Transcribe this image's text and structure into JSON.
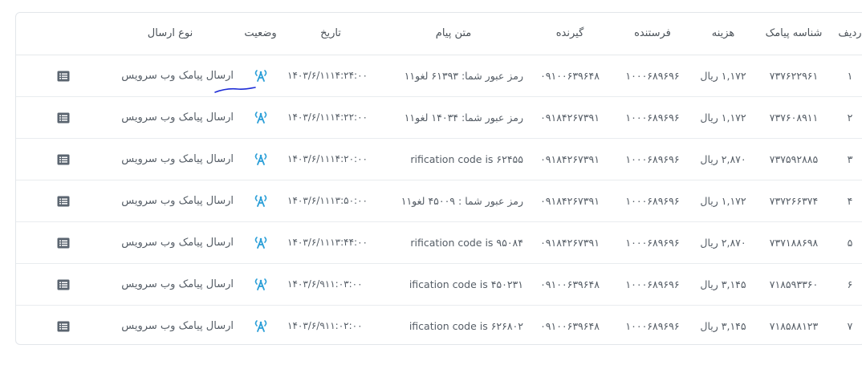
{
  "table": {
    "headers": {
      "row": "ردیف",
      "id": "شناسه پیامک",
      "cost": "هزینه",
      "sender": "فرستنده",
      "receiver": "گیرنده",
      "message": "متن پیام",
      "date": "تاریخ",
      "status": "وضعیت",
      "type": "نوع ارسال"
    },
    "rows": [
      {
        "row": "۱",
        "id": "۷۳۷۶۲۲۹۶۱",
        "cost": "۱,۱۷۲ ریال",
        "sender": "۱۰۰۰۶۸۹۶۹۶",
        "receiver": "۰۹۱۰۰۶۳۹۶۴۸",
        "message": "رمز عبور شما: ۶۱۳۹۳ لغو۱۱",
        "time": "۱۴:۲۴:۰۰",
        "date": "۱۴۰۳/۶/۱۱",
        "type": "ارسال پیامک وب سرویس"
      },
      {
        "row": "۲",
        "id": "۷۳۷۶۰۸۹۱۱",
        "cost": "۱,۱۷۲ ریال",
        "sender": "۱۰۰۰۶۸۹۶۹۶",
        "receiver": "۰۹۱۸۴۲۶۷۳۹۱",
        "message": "رمز عبور شما: ۱۴۰۳۴ لغو۱۱",
        "time": "۱۴:۲۲:۰۰",
        "date": "۱۴۰۳/۶/۱۱",
        "type": "ارسال پیامک وب سرویس"
      },
      {
        "row": "۳",
        "id": "۷۳۷۵۹۲۸۸۵",
        "cost": "۲,۸۷۰ ریال",
        "sender": "۱۰۰۰۶۸۹۶۹۶",
        "receiver": "۰۹۱۸۴۲۶۷۳۹۱",
        "message": "rification code is ۶۲۴۵۵",
        "time": "۱۴:۲۰:۰۰",
        "date": "۱۴۰۳/۶/۱۱",
        "type": "ارسال پیامک وب سرویس"
      },
      {
        "row": "۴",
        "id": "۷۳۷۲۶۶۳۷۴",
        "cost": "۱,۱۷۲ ریال",
        "sender": "۱۰۰۰۶۸۹۶۹۶",
        "receiver": "۰۹۱۸۴۲۶۷۳۹۱",
        "message": "رمز عبور شما : ۴۵۰۰۹ لغو۱۱",
        "time": "۱۳:۵۰:۰۰",
        "date": "۱۴۰۳/۶/۱۱",
        "type": "ارسال پیامک وب سرویس"
      },
      {
        "row": "۵",
        "id": "۷۳۷۱۸۸۶۹۸",
        "cost": "۲,۸۷۰ ریال",
        "sender": "۱۰۰۰۶۸۹۶۹۶",
        "receiver": "۰۹۱۸۴۲۶۷۳۹۱",
        "message": "rification code is ۹۵۰۸۴",
        "time": "۱۳:۴۴:۰۰",
        "date": "۱۴۰۳/۶/۱۱",
        "type": "ارسال پیامک وب سرویس"
      },
      {
        "row": "۶",
        "id": "۷۱۸۵۹۳۳۶۰",
        "cost": "۳,۱۴۵ ریال",
        "sender": "۱۰۰۰۶۸۹۶۹۶",
        "receiver": "۰۹۱۰۰۶۳۹۶۴۸",
        "message": "ification code is ۴۵۰۲۳۱",
        "time": "۱۱:۰۳:۰۰",
        "date": "۱۴۰۳/۶/۹",
        "type": "ارسال پیامک وب سرویس"
      },
      {
        "row": "۷",
        "id": "۷۱۸۵۸۸۱۲۳",
        "cost": "۳,۱۴۵ ریال",
        "sender": "۱۰۰۰۶۸۹۶۹۶",
        "receiver": "۰۹۱۰۰۶۳۹۶۴۸",
        "message": "ification code is ۶۲۶۸۰۲",
        "time": "۱۱:۰۲:۰۰",
        "date": "۱۴۰۳/۶/۹",
        "type": "ارسال پیامک وب سرویس"
      }
    ]
  },
  "icons": {
    "status": "antenna-signal-icon",
    "action": "list-details-icon"
  },
  "colors": {
    "status_icon": "#2b9fd8",
    "action_icon": "#5b6570",
    "scribble": "#1d2cd6"
  }
}
